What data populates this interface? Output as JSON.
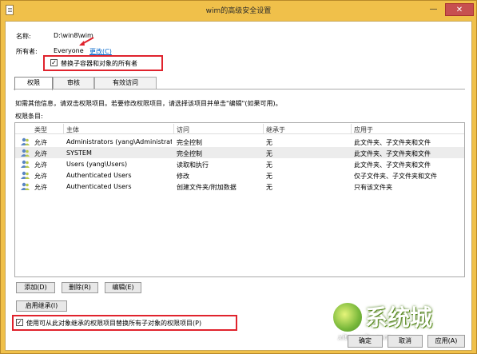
{
  "window": {
    "title": "wim的高级安全设置",
    "min_glyph": "—",
    "close_glyph": "✕"
  },
  "info": {
    "name_label": "名称:",
    "name_value": "D:\\win8\\wim",
    "owner_label": "所有者:",
    "owner_value": "Everyone",
    "owner_change": "更改(C)",
    "replace_owner_label": "替换子容器和对象的所有者",
    "replace_owner_checked": true
  },
  "tabs": [
    {
      "label": "权限"
    },
    {
      "label": "审核"
    },
    {
      "label": "有效访问"
    }
  ],
  "info_text": "如需其他信息，请双击权限项目。若要修改权限项目，请选择该项目并单击\"编辑\"(如果可用)。",
  "entries_label": "权限条目:",
  "table": {
    "columns": [
      "类型",
      "主体",
      "访问",
      "继承于",
      "应用于"
    ],
    "rows": [
      {
        "type": "允许",
        "principal": "Administrators (yang\\Administrat...",
        "access": "完全控制",
        "inherit": "无",
        "applies": "此文件夹、子文件夹和文件"
      },
      {
        "type": "允许",
        "principal": "SYSTEM",
        "access": "完全控制",
        "inherit": "无",
        "applies": "此文件夹、子文件夹和文件"
      },
      {
        "type": "允许",
        "principal": "Users (yang\\Users)",
        "access": "读取和执行",
        "inherit": "无",
        "applies": "此文件夹、子文件夹和文件"
      },
      {
        "type": "允许",
        "principal": "Authenticated Users",
        "access": "修改",
        "inherit": "无",
        "applies": "仅子文件夹、子文件夹和文件"
      },
      {
        "type": "允许",
        "principal": "Authenticated Users",
        "access": "创建文件夹/附加数据",
        "inherit": "无",
        "applies": "只有该文件夹"
      }
    ]
  },
  "buttons": {
    "add": "添加(D)",
    "remove": "删除(R)",
    "edit": "编辑(E)",
    "enable_inherit": "启用继承(I)",
    "ok": "确定",
    "cancel": "取消",
    "apply": "应用(A)"
  },
  "replace_child": {
    "label": "使用可从此对象继承的权限项目替换所有子对象的权限项目(P)",
    "checked": true
  },
  "watermark": {
    "text": "系统城",
    "sub": "xitongcity.com"
  },
  "colors": {
    "highlight": "#e0232d",
    "title_bar": "#f0c04a",
    "link": "#0066cc"
  }
}
